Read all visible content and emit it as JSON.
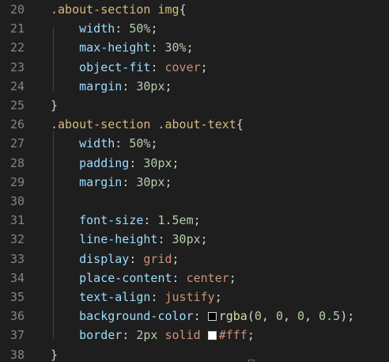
{
  "editor": {
    "lines": [
      {
        "num": "20",
        "tokens": [
          {
            "t": ".about-section img",
            "c": "sel"
          },
          {
            "t": "{",
            "c": "punc"
          }
        ]
      },
      {
        "num": "21",
        "tokens": [
          {
            "t": "    ",
            "c": "punc"
          },
          {
            "t": "width",
            "c": "prop"
          },
          {
            "t": ": ",
            "c": "punc"
          },
          {
            "t": "50%",
            "c": "num"
          },
          {
            "t": ";",
            "c": "punc"
          }
        ]
      },
      {
        "num": "22",
        "tokens": [
          {
            "t": "    ",
            "c": "punc"
          },
          {
            "t": "max-height",
            "c": "prop"
          },
          {
            "t": ": ",
            "c": "punc"
          },
          {
            "t": "30%",
            "c": "num"
          },
          {
            "t": ";",
            "c": "punc"
          }
        ]
      },
      {
        "num": "23",
        "tokens": [
          {
            "t": "    ",
            "c": "punc"
          },
          {
            "t": "object-fit",
            "c": "prop"
          },
          {
            "t": ": ",
            "c": "punc"
          },
          {
            "t": "cover",
            "c": "kw"
          },
          {
            "t": ";",
            "c": "punc"
          }
        ]
      },
      {
        "num": "24",
        "tokens": [
          {
            "t": "    ",
            "c": "punc"
          },
          {
            "t": "margin",
            "c": "prop"
          },
          {
            "t": ": ",
            "c": "punc"
          },
          {
            "t": "30px",
            "c": "num"
          },
          {
            "t": ";",
            "c": "punc"
          }
        ]
      },
      {
        "num": "25",
        "tokens": [
          {
            "t": "}",
            "c": "punc"
          }
        ]
      },
      {
        "num": "26",
        "tokens": [
          {
            "t": ".about-section .about-text",
            "c": "sel"
          },
          {
            "t": "{",
            "c": "punc"
          }
        ]
      },
      {
        "num": "27",
        "tokens": [
          {
            "t": "    ",
            "c": "punc"
          },
          {
            "t": "width",
            "c": "prop"
          },
          {
            "t": ": ",
            "c": "punc"
          },
          {
            "t": "50%",
            "c": "num"
          },
          {
            "t": ";",
            "c": "punc"
          }
        ]
      },
      {
        "num": "28",
        "tokens": [
          {
            "t": "    ",
            "c": "punc"
          },
          {
            "t": "padding",
            "c": "prop"
          },
          {
            "t": ": ",
            "c": "punc"
          },
          {
            "t": "30px",
            "c": "num"
          },
          {
            "t": ";",
            "c": "punc"
          }
        ]
      },
      {
        "num": "29",
        "tokens": [
          {
            "t": "    ",
            "c": "punc"
          },
          {
            "t": "margin",
            "c": "prop"
          },
          {
            "t": ": ",
            "c": "punc"
          },
          {
            "t": "30px",
            "c": "num"
          },
          {
            "t": ";",
            "c": "punc"
          }
        ]
      },
      {
        "num": "30",
        "tokens": []
      },
      {
        "num": "31",
        "tokens": [
          {
            "t": "    ",
            "c": "punc"
          },
          {
            "t": "font-size",
            "c": "prop"
          },
          {
            "t": ": ",
            "c": "punc"
          },
          {
            "t": "1.5em",
            "c": "num"
          },
          {
            "t": ";",
            "c": "punc"
          }
        ]
      },
      {
        "num": "32",
        "tokens": [
          {
            "t": "    ",
            "c": "punc"
          },
          {
            "t": "line-height",
            "c": "prop"
          },
          {
            "t": ": ",
            "c": "punc"
          },
          {
            "t": "30px",
            "c": "num"
          },
          {
            "t": ";",
            "c": "punc"
          }
        ]
      },
      {
        "num": "33",
        "tokens": [
          {
            "t": "    ",
            "c": "punc"
          },
          {
            "t": "display",
            "c": "prop"
          },
          {
            "t": ": ",
            "c": "punc"
          },
          {
            "t": "grid",
            "c": "kw"
          },
          {
            "t": ";",
            "c": "punc"
          }
        ]
      },
      {
        "num": "34",
        "tokens": [
          {
            "t": "    ",
            "c": "punc"
          },
          {
            "t": "place-content",
            "c": "prop"
          },
          {
            "t": ": ",
            "c": "punc"
          },
          {
            "t": "center",
            "c": "kw"
          },
          {
            "t": ";",
            "c": "punc"
          }
        ]
      },
      {
        "num": "35",
        "tokens": [
          {
            "t": "    ",
            "c": "punc"
          },
          {
            "t": "text-align",
            "c": "prop"
          },
          {
            "t": ": ",
            "c": "punc"
          },
          {
            "t": "justify",
            "c": "kw"
          },
          {
            "t": ";",
            "c": "punc"
          }
        ]
      },
      {
        "num": "36",
        "tokens": [
          {
            "t": "    ",
            "c": "punc"
          },
          {
            "t": "background-color",
            "c": "prop"
          },
          {
            "t": ": ",
            "c": "punc"
          },
          {
            "swatch": "#000000"
          },
          {
            "t": "rgba",
            "c": "fn"
          },
          {
            "t": "(",
            "c": "punc"
          },
          {
            "t": "0",
            "c": "num"
          },
          {
            "t": ", ",
            "c": "punc"
          },
          {
            "t": "0",
            "c": "num"
          },
          {
            "t": ", ",
            "c": "punc"
          },
          {
            "t": "0",
            "c": "num"
          },
          {
            "t": ", ",
            "c": "punc"
          },
          {
            "t": "0.5",
            "c": "num"
          },
          {
            "t": ");",
            "c": "punc"
          }
        ]
      },
      {
        "num": "37",
        "tokens": [
          {
            "t": "    ",
            "c": "punc"
          },
          {
            "t": "border",
            "c": "prop"
          },
          {
            "t": ": ",
            "c": "punc"
          },
          {
            "t": "2px",
            "c": "num"
          },
          {
            "t": " ",
            "c": "punc"
          },
          {
            "t": "solid",
            "c": "kw"
          },
          {
            "t": " ",
            "c": "punc"
          },
          {
            "swatch": "#ffffff"
          },
          {
            "t": "#fff",
            "c": "kw"
          },
          {
            "t": ";",
            "c": "punc"
          }
        ]
      },
      {
        "num": "38",
        "tokens": [
          {
            "t": "}",
            "c": "punc"
          }
        ]
      }
    ]
  },
  "colors": {
    "background": "#1e1e1e",
    "line_number": "#858585",
    "selector": "#d7ba7d",
    "property": "#9cdcfe",
    "number": "#b5cea8",
    "keyword": "#ce9178",
    "function": "#dcdcaa",
    "punctuation": "#d4d4d4"
  }
}
